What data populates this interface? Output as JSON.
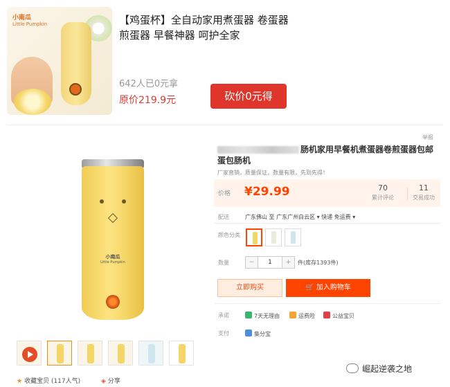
{
  "promo": {
    "title": "【鸡蛋杯】全自动家用煮蛋器 卷蛋器 煎蛋器 早餐神器 呵护全家",
    "count": "642人已0元拿",
    "original_price": "原价219.9元",
    "button": "砍价0元得",
    "logo": "小南瓜",
    "logo_sub": "Little Pumpkin"
  },
  "product": {
    "report": "举报",
    "title_visible": "肠机家用早餐机煮蛋器卷煎蛋器包邮蛋包肠机",
    "subtitle": "厂家直销，质量保证，数量有限，先到先得！",
    "price_label": "价格",
    "price": "¥29.99",
    "stats": [
      {
        "value": "70",
        "label": "累计评论"
      },
      {
        "value": "11",
        "label": "交易成功"
      }
    ],
    "shipping": {
      "label": "配送",
      "from": "广东佛山",
      "to_word": "至",
      "to": "广东广州白云区",
      "method": "快递 免运费"
    },
    "color": {
      "label": "颜色分类",
      "options": [
        "#f4d668",
        "#e8ecd8",
        "#cfe6ee"
      ]
    },
    "quantity": {
      "label": "数量",
      "value": "1",
      "minus": "−",
      "plus": "+",
      "stock": "件(库存1393件)"
    },
    "buy_now": "立即购买",
    "add_cart": "加入购物车",
    "promise": {
      "label": "承诺",
      "items": [
        "7天无理由",
        "运费险",
        "公益宝贝"
      ]
    },
    "pay": {
      "label": "支付",
      "item": "集分宝"
    },
    "brand": "小南瓜",
    "brand_sub": "Little Pumpkin"
  },
  "gallery": {
    "collect": "收藏宝贝 (117人气)",
    "share": "分享"
  },
  "watermark": "崛起逆袭之地",
  "colors": {
    "accent": "#ff4400",
    "promo_red": "#e0352b"
  }
}
